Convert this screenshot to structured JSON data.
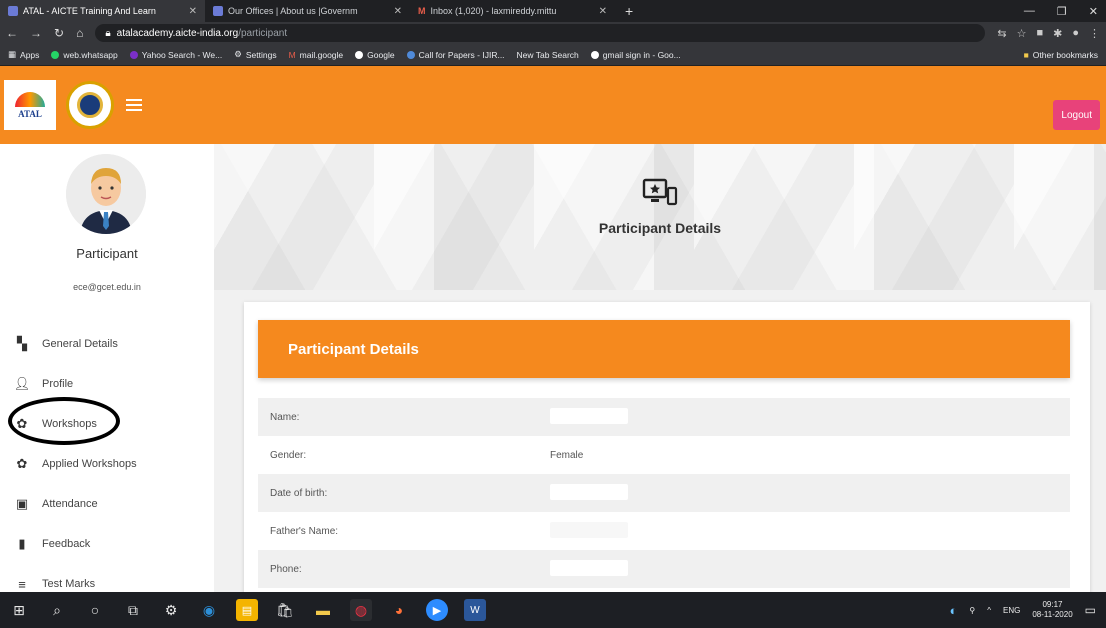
{
  "browser": {
    "tabs": [
      {
        "label": "ATAL - AICTE Training And Learn",
        "active": true
      },
      {
        "label": "Our Offices | About us |Governm",
        "active": false
      },
      {
        "label": "Inbox (1,020) - laxmireddy.mittu",
        "active": false
      }
    ],
    "new_tab": "+",
    "url_host": "atalacademy.aicte-india.org",
    "url_path": "/participant",
    "bookmarks": [
      "Apps",
      "web.whatsapp",
      "Yahoo Search - We...",
      "Settings",
      "mail.google",
      "Google",
      "Call for Papers - IJIR...",
      "New Tab Search",
      "gmail sign in - Goo...",
      "Other bookmarks"
    ]
  },
  "header": {
    "logo_text": "ATAL",
    "logout_label": "Logout"
  },
  "sidebar": {
    "role": "Participant",
    "email": "ece@gcet.edu.in",
    "items": [
      {
        "label": "General Details",
        "icon": "grid-icon"
      },
      {
        "label": "Profile",
        "icon": "person-icon"
      },
      {
        "label": "Workshops",
        "icon": "workshops-icon"
      },
      {
        "label": "Applied Workshops",
        "icon": "applied-workshops-icon"
      },
      {
        "label": "Attendance",
        "icon": "attendance-icon"
      },
      {
        "label": "Feedback",
        "icon": "feedback-icon"
      },
      {
        "label": "Test Marks",
        "icon": "list-icon"
      }
    ]
  },
  "main": {
    "hero_title": "Participant Details",
    "card_title": "Participant Details",
    "rows": [
      {
        "label": "Name:",
        "value": ""
      },
      {
        "label": "Gender:",
        "value": "Female"
      },
      {
        "label": "Date of birth:",
        "value": ""
      },
      {
        "label": "Father's Name:",
        "value": ""
      },
      {
        "label": "Phone:",
        "value": ""
      }
    ]
  },
  "taskbar": {
    "lang": "ENG",
    "time": "09:17",
    "date": "08-11-2020"
  },
  "colors": {
    "brand_orange": "#f58a1f",
    "logout_pink": "#e8427a"
  }
}
